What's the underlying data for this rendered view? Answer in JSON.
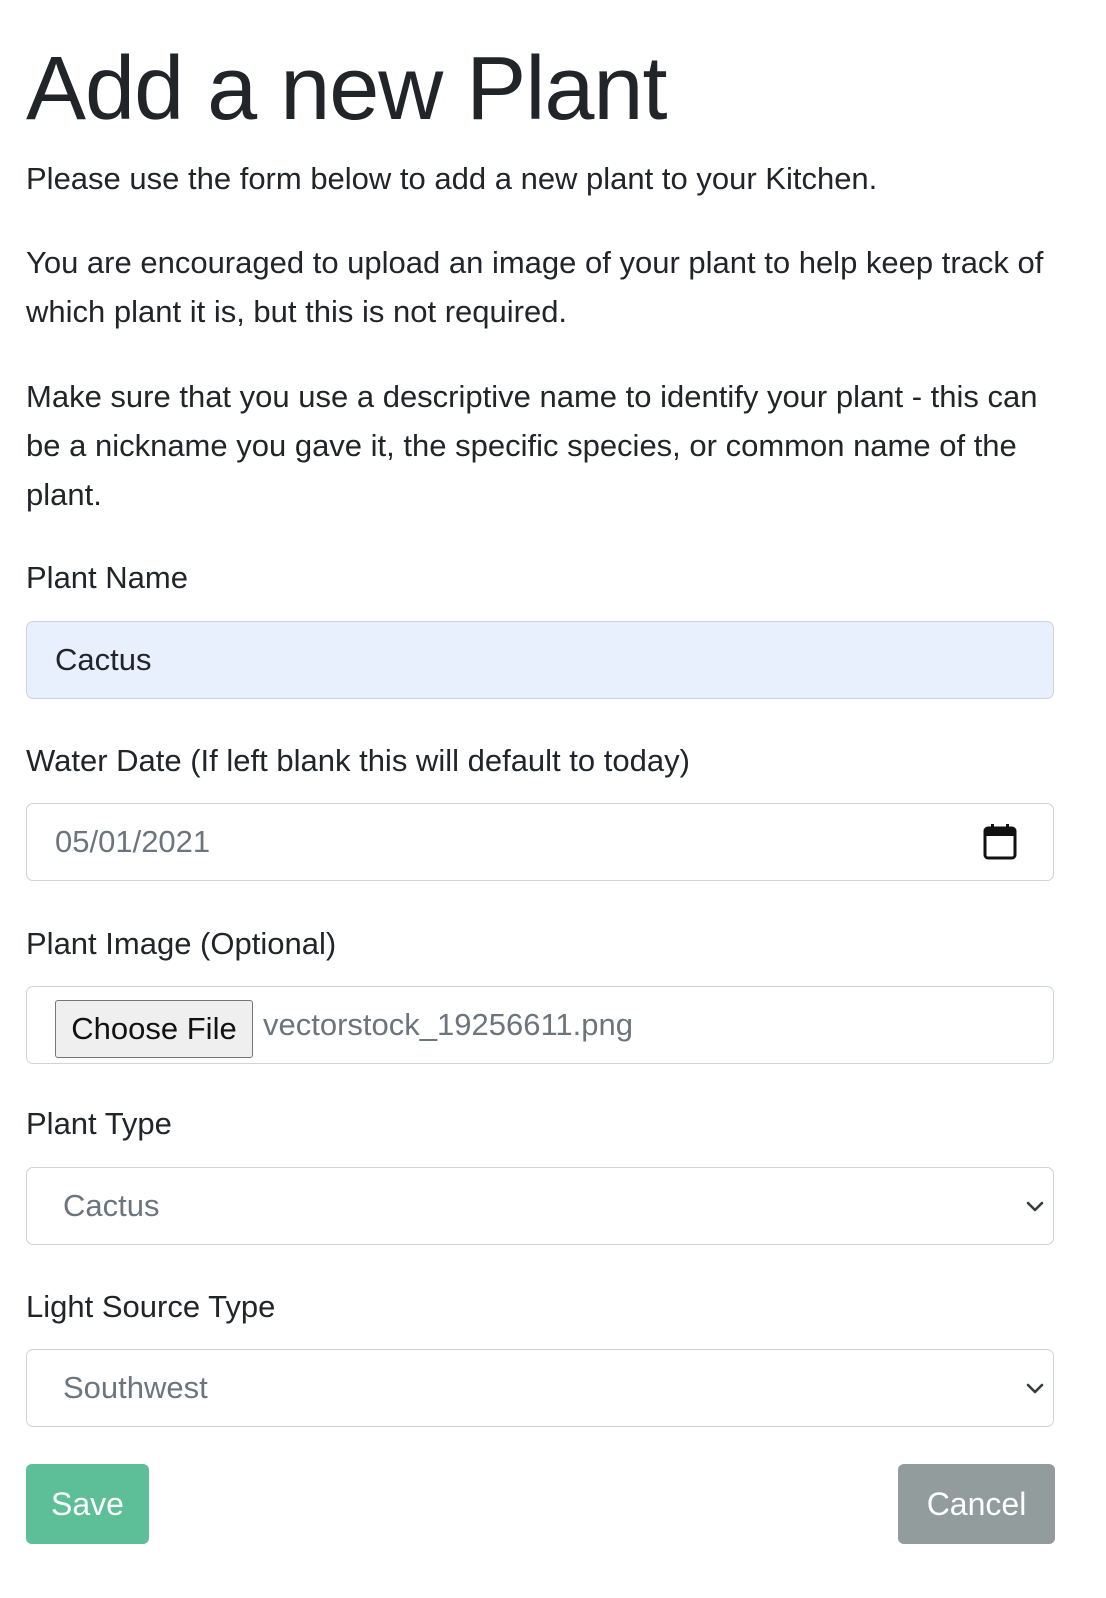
{
  "page": {
    "title": "Add a new Plant",
    "intro": "Please use the form below to add a new plant to your Kitchen.",
    "image_note": "You are encouraged to upload an image of your plant to help keep track of which plant it is, but this is not required.",
    "name_note": "Make sure that you use a descriptive name to identify your plant - this can be a nickname you gave it, the specific species, or common name of the plant."
  },
  "form": {
    "plant_name": {
      "label": "Plant Name",
      "value": "Cactus"
    },
    "water_date": {
      "label": "Water Date (If left blank this will default to today)",
      "value": "05/01/2021",
      "icon": "calendar-icon"
    },
    "plant_image": {
      "label": "Plant Image (Optional)",
      "button_label": "Choose File",
      "file_name": "vectorstock_19256611.png"
    },
    "plant_type": {
      "label": "Plant Type",
      "selected": "Cactus",
      "icon": "chevron-down-icon"
    },
    "light_source": {
      "label": "Light Source Type",
      "selected": "Southwest",
      "icon": "chevron-down-icon"
    }
  },
  "actions": {
    "save_label": "Save",
    "cancel_label": "Cancel"
  },
  "colors": {
    "text": "#212529",
    "muted_text": "#6c757d",
    "autofill_bg": "#e8f0fe",
    "border": "#ced4da",
    "save_bg": "#5cbf98",
    "cancel_bg": "#939c9d"
  }
}
